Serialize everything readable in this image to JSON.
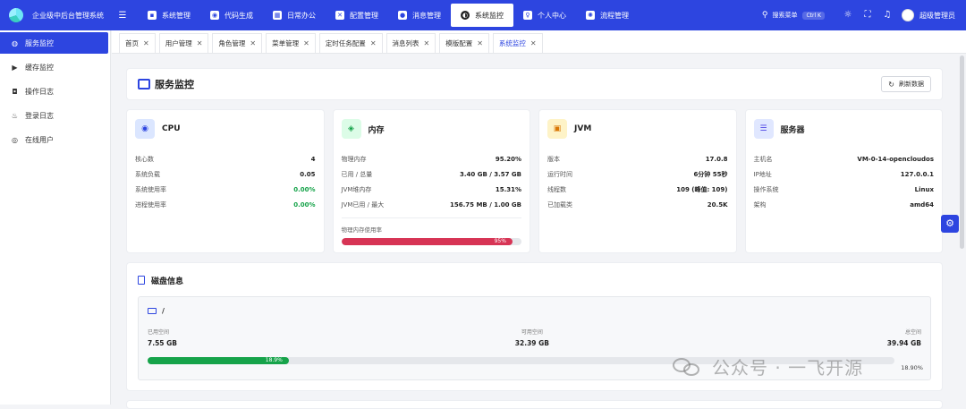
{
  "app": {
    "name": "企业级中后台管理系统",
    "fold_icon": "menu-fold-icon"
  },
  "topmenu": [
    {
      "label": "系统管理",
      "icon": "briefcase-icon"
    },
    {
      "label": "代码生成",
      "icon": "code-icon"
    },
    {
      "label": "日常办公",
      "icon": "calendar-icon"
    },
    {
      "label": "配置管理",
      "icon": "config-icon"
    },
    {
      "label": "消息管理",
      "icon": "message-icon"
    },
    {
      "label": "系统监控",
      "icon": "monitor-icon",
      "active": true
    },
    {
      "label": "个人中心",
      "icon": "person-icon"
    },
    {
      "label": "流程管理",
      "icon": "flow-icon"
    }
  ],
  "header": {
    "search_label": "搜索菜单",
    "search_shortcut": "Ctrl K",
    "user_name": "超级管理员"
  },
  "sidebar": [
    {
      "label": "服务监控",
      "icon": "globe-icon",
      "active": true
    },
    {
      "label": "缓存监控",
      "icon": "play-icon"
    },
    {
      "label": "操作日志",
      "icon": "instagram-icon"
    },
    {
      "label": "登录日志",
      "icon": "fire-icon"
    },
    {
      "label": "在线用户",
      "icon": "record-icon"
    }
  ],
  "tabs": [
    "首页",
    "用户管理",
    "角色管理",
    "菜单管理",
    "定时任务配置",
    "消息列表",
    "模版配置",
    "系统监控"
  ],
  "active_tab": "系统监控",
  "page": {
    "title": "服务监控",
    "refresh_label": "刷新数据"
  },
  "cpu": {
    "title": "CPU",
    "rows": [
      {
        "k": "核心数",
        "v": "4"
      },
      {
        "k": "系统负载",
        "v": "0.05"
      },
      {
        "k": "系统使用率",
        "v": "0.00%",
        "green": true
      },
      {
        "k": "进程使用率",
        "v": "0.00%",
        "green": true
      }
    ]
  },
  "memory": {
    "title": "内存",
    "rows": [
      {
        "k": "物理内存",
        "v": "95.20%"
      },
      {
        "k": "已用 / 总量",
        "v": "3.40 GB / 3.57 GB"
      },
      {
        "k": "JVM堆内存",
        "v": "15.31%"
      },
      {
        "k": "JVM已用 / 最大",
        "v": "156.75 MB / 1.00 GB"
      }
    ],
    "bar_label": "物理内存使用率",
    "bar_percent": 95,
    "bar_text": "95%",
    "bar_color": "#d73455"
  },
  "jvm": {
    "title": "JVM",
    "rows": [
      {
        "k": "版本",
        "v": "17.0.8"
      },
      {
        "k": "运行时间",
        "v": "6分钟 55秒"
      },
      {
        "k": "线程数",
        "v": "109 (峰值: 109)"
      },
      {
        "k": "已加载类",
        "v": "20.5K"
      }
    ]
  },
  "server": {
    "title": "服务器",
    "rows": [
      {
        "k": "主机名",
        "v": "VM-0-14-opencloudos"
      },
      {
        "k": "IP地址",
        "v": "127.0.0.1"
      },
      {
        "k": "操作系统",
        "v": "Linux"
      },
      {
        "k": "架构",
        "v": "amd64"
      }
    ]
  },
  "disk": {
    "title": "磁盘信息",
    "mount": "/",
    "used_label": "已用空间",
    "used": "7.55 GB",
    "free_label": "可用空间",
    "free": "32.39 GB",
    "total_label": "总空间",
    "total": "39.94 GB",
    "percent": 18.9,
    "percent_text": "18.9%",
    "percent_end": "18.90%"
  },
  "watermark": "公众号 · 一飞开源",
  "colors": {
    "primary": "#2d45e0",
    "green": "#16a34a",
    "red": "#d73455"
  }
}
